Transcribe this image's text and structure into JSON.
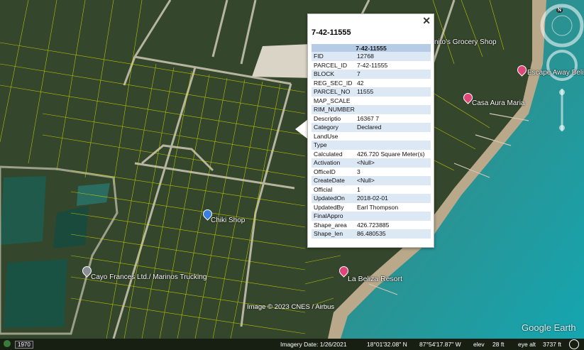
{
  "map": {
    "places": [
      {
        "label": "nito's Grocery Shop",
        "icon": "none"
      },
      {
        "label": "Escape Away Belize V",
        "icon": "pink-pin"
      },
      {
        "label": "Casa Aura Maria",
        "icon": "pink-pin"
      },
      {
        "label": "Chiki Shop",
        "icon": "blue-pin"
      },
      {
        "label": "Cayo Frances Ltd./ Marinos Trucking",
        "icon": "grey-pin"
      },
      {
        "label": "La Beliza Resort",
        "icon": "pink-pin"
      }
    ],
    "image_credit": "Image © 2023 CNES / Airbus",
    "watermark": "Google Earth",
    "compass_label": "N"
  },
  "popup": {
    "title": "7-42-11555",
    "table_header": "7-42-11555",
    "rows": [
      {
        "key": "FID",
        "value": "12768"
      },
      {
        "key": "PARCEL_ID",
        "value": "7-42-11555"
      },
      {
        "key": "BLOCK",
        "value": "7"
      },
      {
        "key": "REG_SEC_ID",
        "value": "42"
      },
      {
        "key": "PARCEL_NO",
        "value": "11555"
      },
      {
        "key": "MAP_SCALE",
        "value": ""
      },
      {
        "key": "RIM_NUMBER",
        "value": ""
      },
      {
        "key": "Descriptio",
        "value": "16367 7"
      },
      {
        "key": "Category",
        "value": "Declared"
      },
      {
        "key": "LandUse",
        "value": ""
      },
      {
        "key": "Type",
        "value": ""
      },
      {
        "key": "Calculated",
        "value": "426.720 Square Meter(s)"
      },
      {
        "key": "Activation",
        "value": "<Null>"
      },
      {
        "key": "OfficeID",
        "value": "3"
      },
      {
        "key": "CreateDate",
        "value": "<Null>"
      },
      {
        "key": "Official",
        "value": "1"
      },
      {
        "key": "UpdatedOn",
        "value": "2018-02-01"
      },
      {
        "key": "UpdatedBy",
        "value": "Earl Thompson"
      },
      {
        "key": "FinalAppro",
        "value": ""
      },
      {
        "key": "Shape_area",
        "value": "426.723885"
      },
      {
        "key": "Shape_len",
        "value": "86.480535"
      }
    ]
  },
  "status": {
    "year": "1970",
    "imagery_date": "Imagery Date: 1/26/2021",
    "latitude": "18°01'32.08\" N",
    "longitude": "87°54'17.87\" W",
    "elev_label": "elev",
    "elev_value": "28 ft",
    "eye_alt_label": "eye alt",
    "eye_alt_value": "3737 ft"
  }
}
